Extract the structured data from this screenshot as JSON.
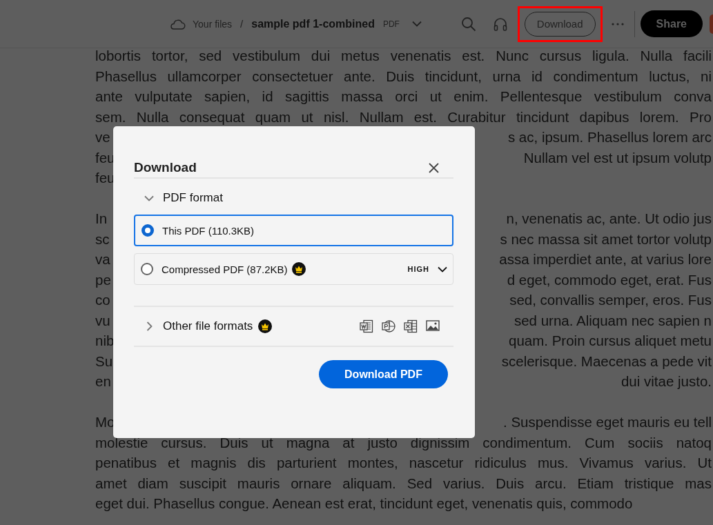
{
  "top_bar": {
    "breadcrumb_root": "Your files",
    "separator": "/",
    "file_name": "sample pdf 1-combined",
    "file_type": "PDF",
    "download_button": "Download",
    "download_highlighted": true,
    "share_button": "Share"
  },
  "document": {
    "paragraphs": [
      [
        {
          "left": "lobortis tortor, sed vestibulum dui metus venenatis est. Nunc cursus ligula. Nulla facili"
        },
        {
          "left": "Phasellus ullamcorper consectetuer ante. Duis tincidunt, urna id condimentum luctus, ni"
        },
        {
          "left": "ante vulputate sapien, id sagittis massa orci ut enim. Pellentesque vestibulum conva"
        },
        {
          "left": "sem. Nulla consequat quam ut nisl. Nullam est. Curabitur tincidunt dapibus lorem. Pro"
        },
        {
          "left": "ve",
          "right": "s ac, ipsum. Phasellus lorem arc"
        },
        {
          "left": "feu",
          "right": "Nullam vel est ut ipsum volutp"
        },
        {
          "left": "feu"
        }
      ],
      [
        {
          "left": "In",
          "right": "n, venenatis ac, ante. Ut odio jus"
        },
        {
          "left": "sc",
          "right": "s nec massa sit amet tortor volutp"
        },
        {
          "left": "va",
          "right": "assa imperdiet ante, at varius lore"
        },
        {
          "left": "pe",
          "right": "d eget, commodo eget, erat. Fus"
        },
        {
          "left": "co",
          "right": "sed, convallis semper, eros. Fus"
        },
        {
          "left": "vu",
          "right": "sed urna. Aliquam nec sapien n"
        },
        {
          "left": "nib",
          "right": "quam. Proin cursus aliquet metu"
        },
        {
          "left": "Su",
          "right": "scelerisque. Maecenas a pede vit"
        },
        {
          "left": "en",
          "right": "dui vitae justo."
        }
      ],
      [
        {
          "left": "Mo",
          "right": ". Suspendisse eget mauris eu tell"
        },
        {
          "left": "molestie cursus. Duis ut magna at justo dignissim condimentum. Cum sociis natoq"
        },
        {
          "left": "penatibus et magnis dis parturient montes, nascetur ridiculus mus. Vivamus varius. Ut"
        },
        {
          "left": "amet diam suscipit mauris ornare aliquam. Sed varius. Duis arcu. Etiam tristique mas"
        },
        {
          "left": "eget dui. Phasellus congue. Aenean est erat, tincidunt eget, venenatis quis, commodo"
        }
      ]
    ]
  },
  "dialog": {
    "title": "Download",
    "sections": [
      {
        "kind": "pdf",
        "title": "PDF format",
        "expanded": true,
        "options": [
          {
            "label": "This PDF (110.3KB)",
            "selected": true
          },
          {
            "label": "Compressed PDF (87.2KB)",
            "selected": false,
            "premium": true,
            "quality": "HIGH"
          }
        ]
      },
      {
        "kind": "other",
        "title": "Other file formats",
        "expanded": false,
        "premium": true
      }
    ],
    "primary_button": "Download PDF"
  }
}
